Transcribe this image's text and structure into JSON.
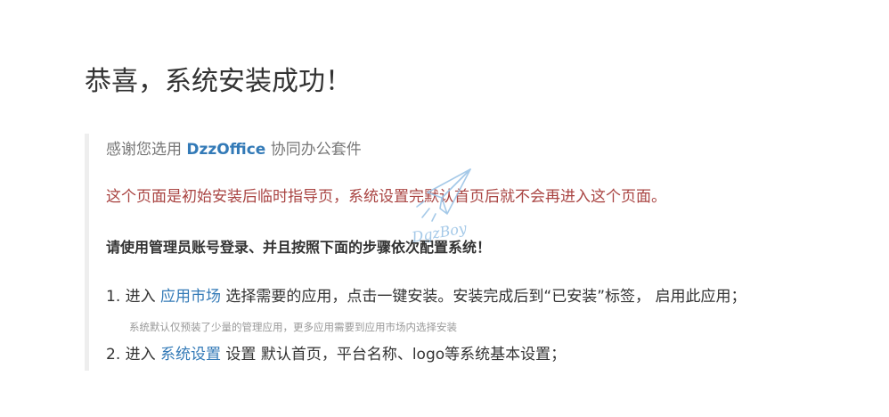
{
  "title": "恭喜，系统安装成功！",
  "thanks": {
    "prefix": "感谢您选用 ",
    "brand": "DzzOffice",
    "suffix": " 协同办公套件"
  },
  "notice": "这个页面是初始安装后临时指导页，系统设置完默认首页后就不会再进入这个页面。",
  "instruction": "请使用管理员账号登录、并且按照下面的步骤依次配置系统！",
  "steps": [
    {
      "prefix": "1. 进入 ",
      "link": "应用市场",
      "suffix": " 选择需要的应用，点击一键安装。安装完成后到“已安装”标签， 启用此应用；",
      "hint": "系统默认仅预装了少量的管理应用，更多应用需要到应用市场内选择安装"
    },
    {
      "prefix": "2. 进入 ",
      "link": "系统设置",
      "suffix": " 设置 默认首页，平台名称、logo等系统基本设置；"
    }
  ],
  "watermark": {
    "text": "DgzBoy",
    "icon": "paper-plane-icon",
    "color": "#9cc4e6"
  },
  "colors": {
    "brand": "#337ab7",
    "link": "#337ab7",
    "notice": "#a94442",
    "muted": "#777777",
    "hint": "#999999",
    "quote_border": "#eeeeee"
  }
}
